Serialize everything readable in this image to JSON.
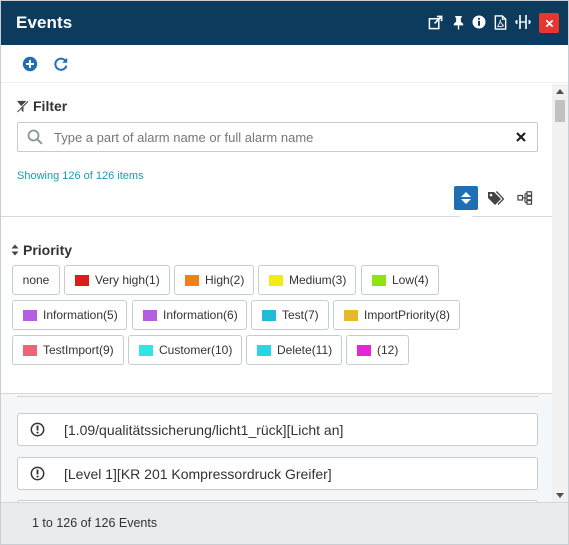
{
  "window": {
    "title": "Events",
    "icons": [
      "external-link-icon",
      "pin-icon",
      "info-icon",
      "pdf-icon",
      "resize-icon",
      "close-icon"
    ]
  },
  "toolbar": {
    "icons": [
      "add-icon",
      "refresh-icon"
    ]
  },
  "filter": {
    "label": "Filter",
    "search_placeholder": "Type a part of alarm name or full alarm name",
    "search_value": "",
    "showing_text": "Showing 126 of 126 items",
    "view_toggles": [
      "sort-icon",
      "tags-icon",
      "hierarchy-icon"
    ]
  },
  "priority": {
    "label": "Priority",
    "chips": [
      {
        "label": "none",
        "color": ""
      },
      {
        "label": "Very high(1)",
        "color": "#e11b1b"
      },
      {
        "label": "High(2)",
        "color": "#f0830f"
      },
      {
        "label": "Medium(3)",
        "color": "#f2ec13"
      },
      {
        "label": "Low(4)",
        "color": "#8fe313"
      },
      {
        "label": "Information(5)",
        "color": "#b35fe0"
      },
      {
        "label": "Information(6)",
        "color": "#b35fe0"
      },
      {
        "label": "Test(7)",
        "color": "#23b9d8"
      },
      {
        "label": "ImportPriority(8)",
        "color": "#eab62b"
      },
      {
        "label": "TestImport(9)",
        "color": "#ec6477"
      },
      {
        "label": "Customer(10)",
        "color": "#34e3e8"
      },
      {
        "label": "Delete(11)",
        "color": "#25d7e3"
      },
      {
        "label": "(12)",
        "color": "#e427d6"
      }
    ]
  },
  "events": [
    {
      "text": "[1.09/qualitätssicherung/licht1_rück][Licht an]"
    },
    {
      "text": "[Level 1][KR 201 Kompressordruck Greifer]"
    }
  ],
  "footer": {
    "text": "1 to 126 of 126 Events"
  },
  "colors": {
    "titlebar": "#0d3b5e",
    "accent": "#1f6fb2",
    "close": "#e8352e",
    "link": "#1a9bb0"
  }
}
